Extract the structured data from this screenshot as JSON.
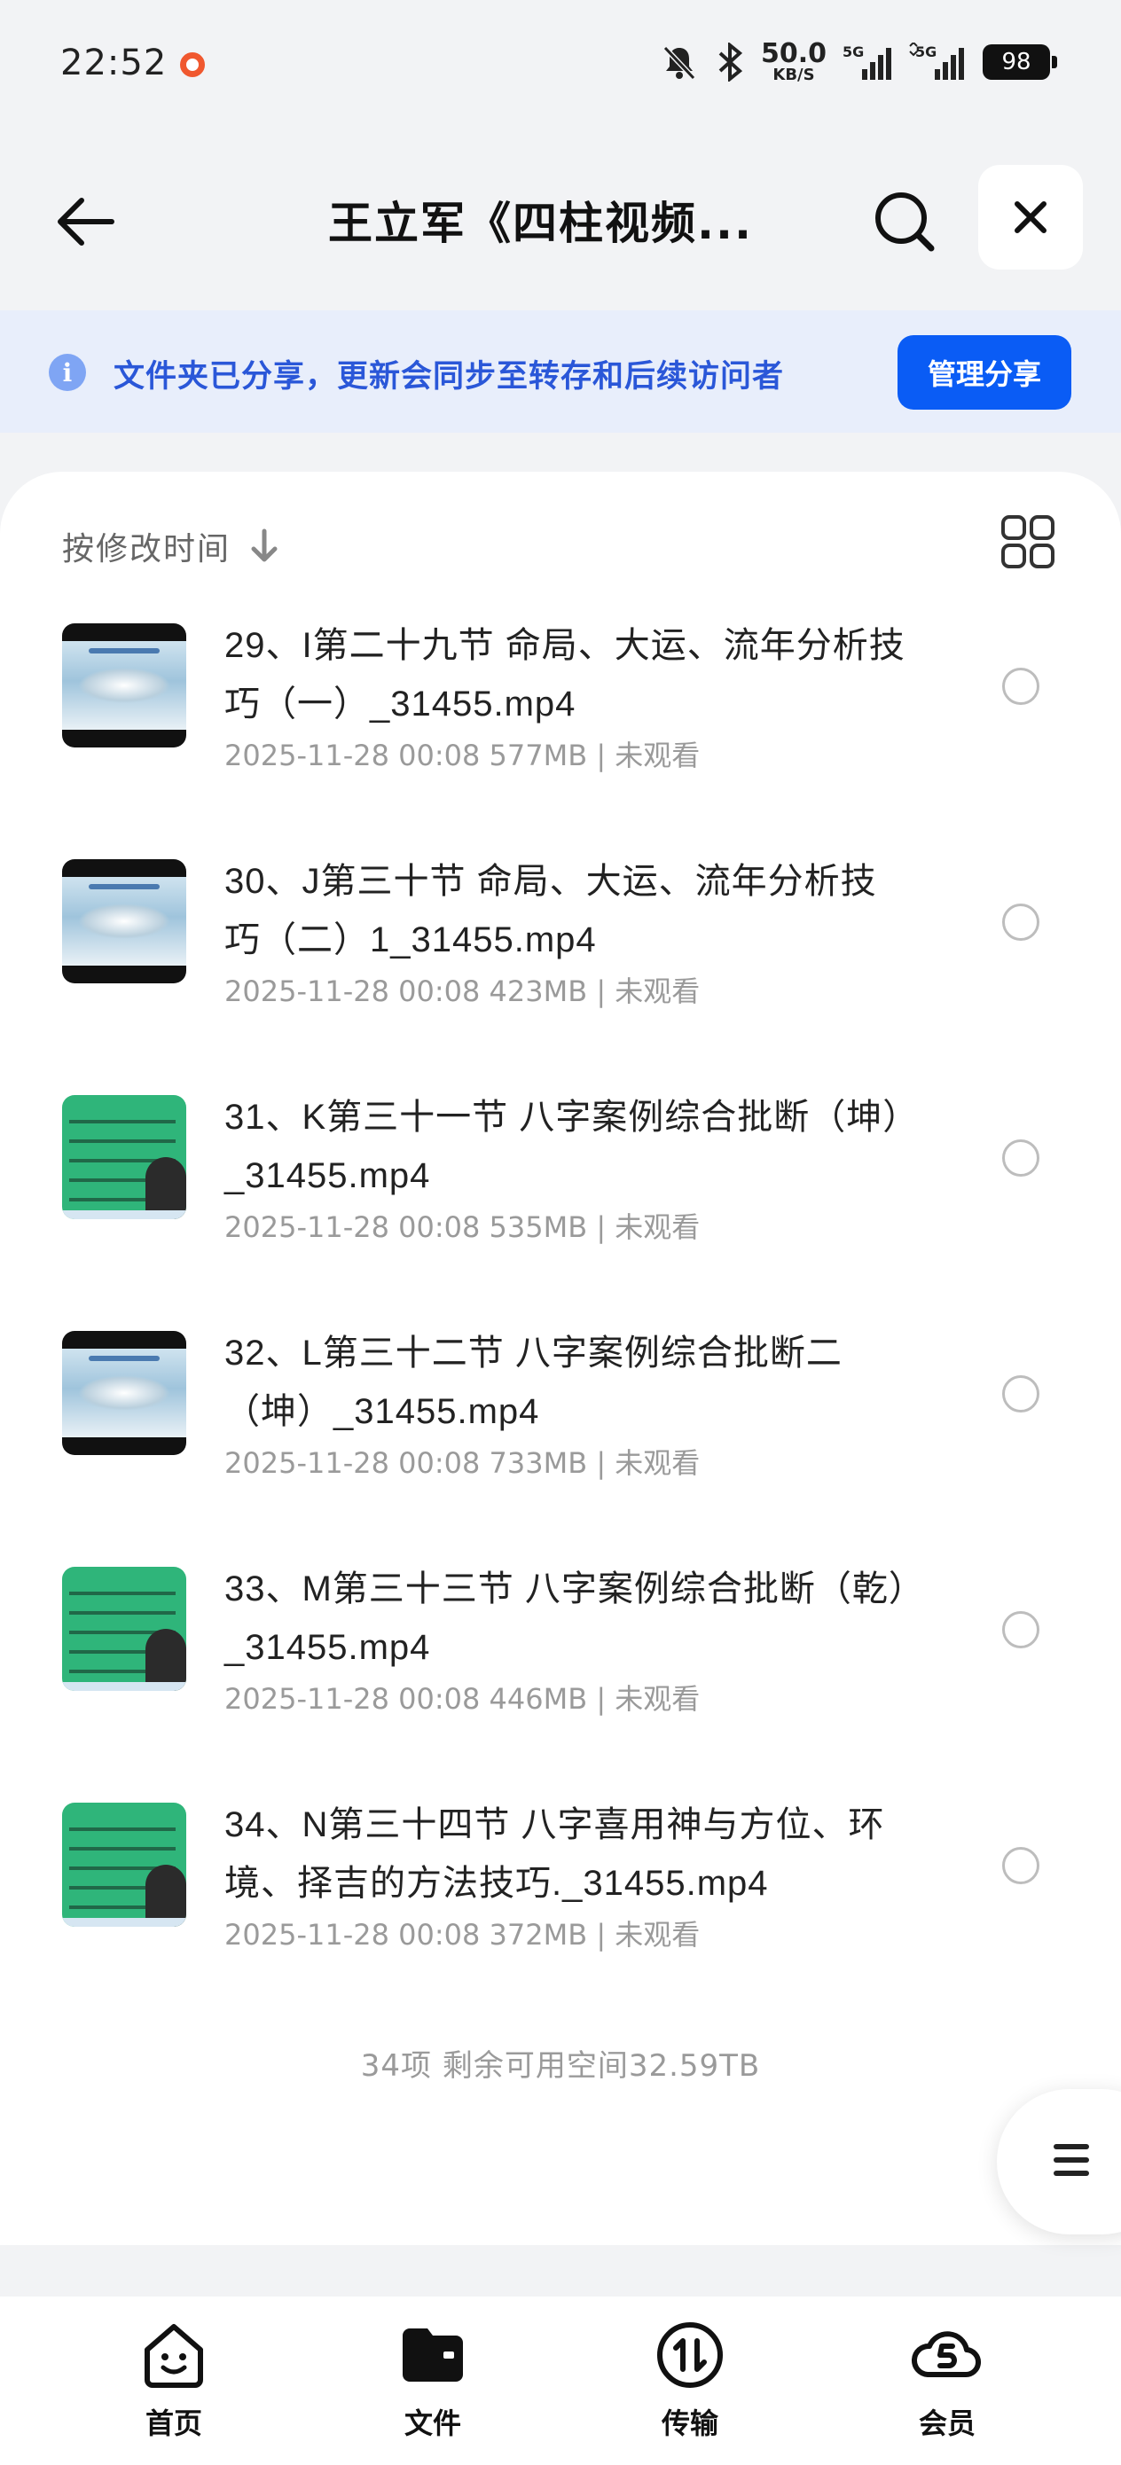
{
  "status_bar": {
    "time": "22:52",
    "net_speed_value": "50.0",
    "net_speed_unit": "KB/S",
    "signal_1": "5G",
    "signal_2": "5G",
    "battery": "98"
  },
  "header": {
    "title": "王立军《四柱视频...",
    "back_icon": "arrow-left-icon",
    "search_icon": "search-icon",
    "close_icon": "close-icon"
  },
  "share_banner": {
    "text": "文件夹已分享，更新会同步至转存和后续访问者",
    "button": "管理分享"
  },
  "sort": {
    "label": "按修改时间",
    "direction_icon": "arrow-down-icon",
    "view_toggle_icon": "grid-view-icon"
  },
  "files": [
    {
      "name": "29、I第二十九节 命局、大运、流年分析技巧（一）_31455.mp4",
      "date": "2025-11-28 00:08",
      "size": "577MB",
      "status": "未观看",
      "thumb": "landscape"
    },
    {
      "name": "30、J第三十节 命局、大运、流年分析技巧（二）1_31455.mp4",
      "date": "2025-11-28 00:08",
      "size": "423MB",
      "status": "未观看",
      "thumb": "landscape"
    },
    {
      "name": "31、K第三十一节 八字案例综合批断（坤）_31455.mp4",
      "date": "2025-11-28 00:08",
      "size": "535MB",
      "status": "未观看",
      "thumb": "board"
    },
    {
      "name": "32、L第三十二节 八字案例综合批断二（坤）_31455.mp4",
      "date": "2025-11-28 00:08",
      "size": "733MB",
      "status": "未观看",
      "thumb": "landscape"
    },
    {
      "name": "33、M第三十三节 八字案例综合批断（乾）_31455.mp4",
      "date": "2025-11-28 00:08",
      "size": "446MB",
      "status": "未观看",
      "thumb": "board"
    },
    {
      "name": "34、N第三十四节 八字喜用神与方位、环境、择吉的方法技巧._31455.mp4",
      "date": "2025-11-28 00:08",
      "size": "372MB",
      "status": "未观看",
      "thumb": "board"
    }
  ],
  "footer": "34项 剩余可用空间32.59TB",
  "bottom_nav": [
    {
      "label": "首页",
      "icon": "home-face-icon"
    },
    {
      "label": "文件",
      "icon": "folder-icon"
    },
    {
      "label": "传输",
      "icon": "transfer-icon"
    },
    {
      "label": "会员",
      "icon": "vip-cloud-icon"
    }
  ],
  "colors": {
    "accent": "#0a5cf5",
    "banner_bg": "#e8eefb",
    "banner_text": "#2a57d8",
    "meta_text": "#9a9a9a"
  }
}
